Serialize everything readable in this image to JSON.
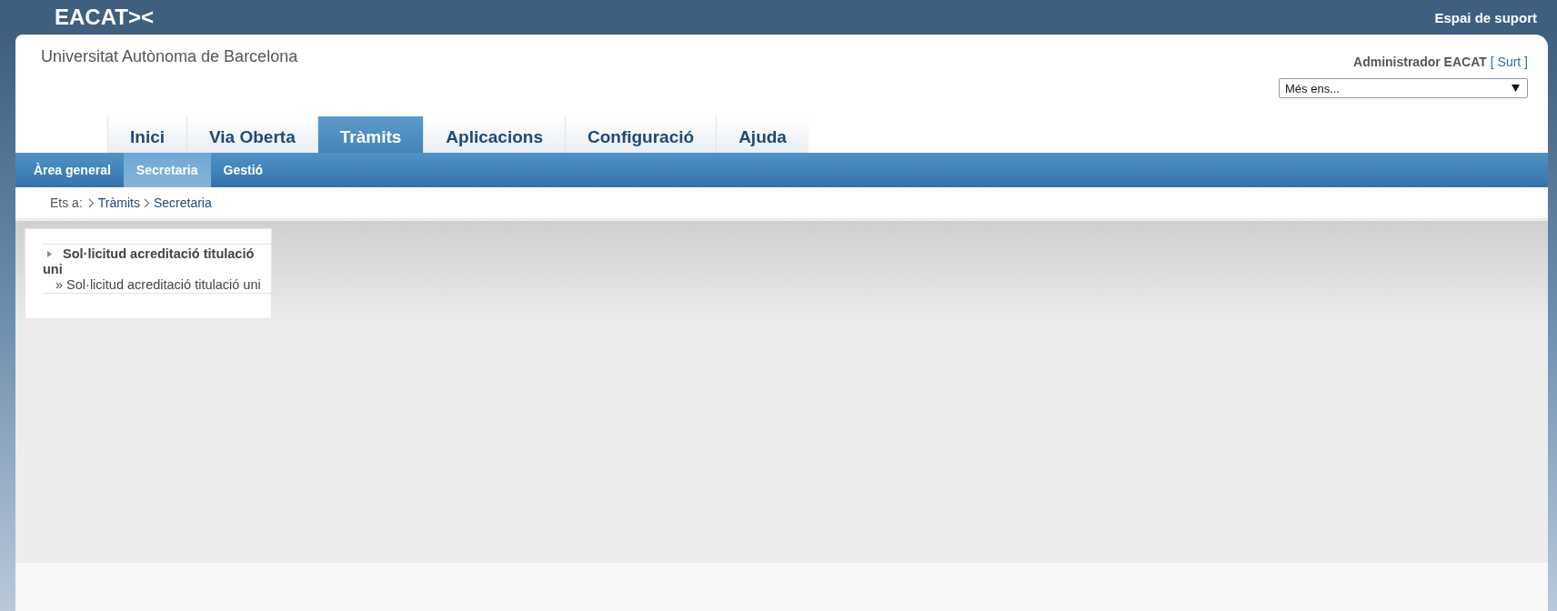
{
  "header": {
    "logo": "EACAT><",
    "support_link": "Espai de suport"
  },
  "org_name": "Universitat Autònoma de Barcelona",
  "user": {
    "name": "Administrador EACAT",
    "logout": "[ Surt ]"
  },
  "entity_select": {
    "value": "Més ens..."
  },
  "tabs": [
    {
      "label": "Inici",
      "selected": false
    },
    {
      "label": "Via Oberta",
      "selected": false
    },
    {
      "label": "Tràmits",
      "selected": true
    },
    {
      "label": "Aplicacions",
      "selected": false
    },
    {
      "label": "Configuració",
      "selected": false
    },
    {
      "label": "Ajuda",
      "selected": false
    }
  ],
  "subtabs": [
    {
      "label": "Àrea general",
      "selected": false
    },
    {
      "label": "Secretaria",
      "selected": true
    },
    {
      "label": "Gestió",
      "selected": false
    }
  ],
  "breadcrumb": {
    "label": "Ets a:",
    "items": [
      "Tràmits",
      "Secretaria"
    ]
  },
  "menu": [
    {
      "label": "Sol·licitud acreditació titulació uni",
      "children": [
        {
          "bullet": "»",
          "label": "Sol·licitud acreditació titulació uni"
        }
      ]
    }
  ]
}
